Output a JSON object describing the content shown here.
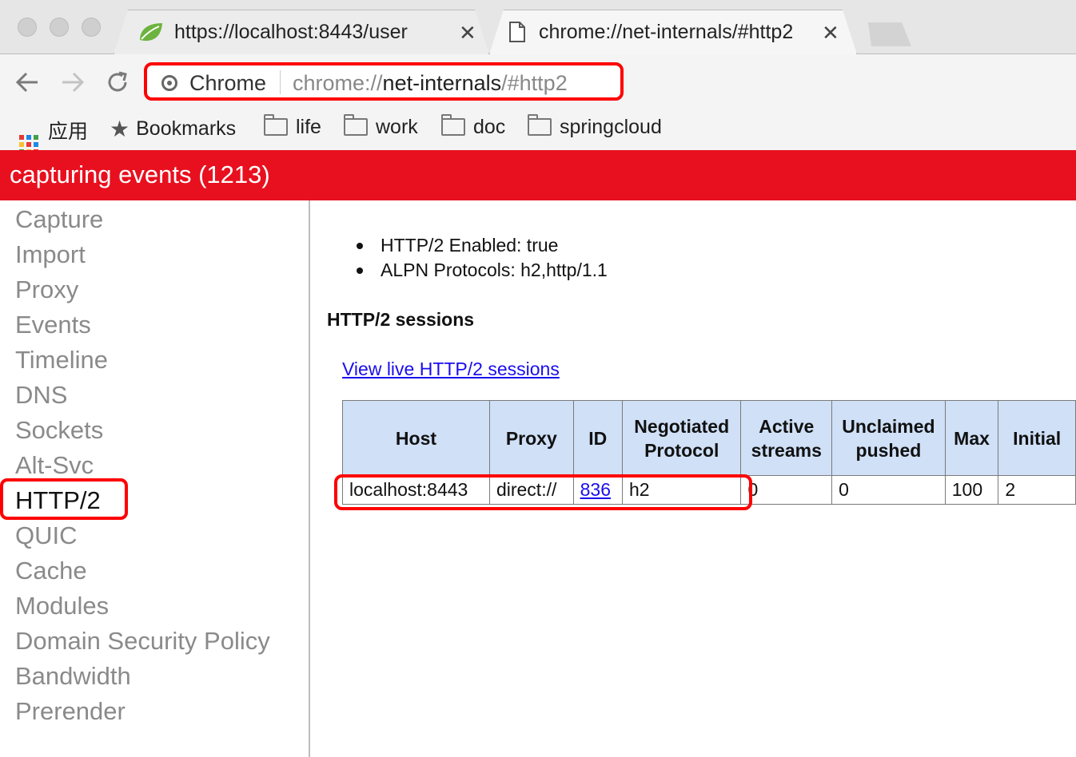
{
  "browser": {
    "tabs": [
      {
        "title": "https://localhost:8443/user",
        "icon": "spring-leaf-icon",
        "active": false
      },
      {
        "title": "chrome://net-internals/#http2",
        "icon": "document-icon",
        "active": true
      }
    ],
    "close_glyph": "✕",
    "omnibox": {
      "site_label": "Chrome",
      "url_scheme": "chrome://",
      "url_host": "net-internals",
      "url_path": "/#http2"
    },
    "bookmarks": [
      {
        "label": "应用",
        "icon": "apps-grid-icon"
      },
      {
        "label": "Bookmarks",
        "icon": "star-icon"
      },
      {
        "label": "life",
        "icon": "folder-icon"
      },
      {
        "label": "work",
        "icon": "folder-icon"
      },
      {
        "label": "doc",
        "icon": "folder-icon"
      },
      {
        "label": "springcloud",
        "icon": "folder-icon"
      }
    ]
  },
  "banner": {
    "text": "capturing events (1213)",
    "color": "#e8101f"
  },
  "sidebar": {
    "items": [
      "Capture",
      "Import",
      "Proxy",
      "Events",
      "Timeline",
      "DNS",
      "Sockets",
      "Alt-Svc",
      "HTTP/2",
      "QUIC",
      "Cache",
      "Modules",
      "Domain Security Policy",
      "Bandwidth",
      "Prerender"
    ],
    "selected": "HTTP/2"
  },
  "main": {
    "status": [
      "HTTP/2 Enabled: true",
      "ALPN Protocols: h2,http/1.1"
    ],
    "sessions_heading": "HTTP/2 sessions",
    "view_live_link": "View live HTTP/2 sessions",
    "table": {
      "headers": [
        "Host",
        "Proxy",
        "ID",
        "Negotiated\nProtocol",
        "Active\nstreams",
        "Unclaimed\npushed",
        "Max",
        "Initial"
      ],
      "rows": [
        [
          "localhost:8443",
          "direct://",
          "836",
          "h2",
          "0",
          "0",
          "100",
          "2"
        ]
      ]
    }
  },
  "colors": {
    "highlight": "#ff0000",
    "table_header_bg": "#cfe0f7",
    "link": "#1a0dee"
  }
}
